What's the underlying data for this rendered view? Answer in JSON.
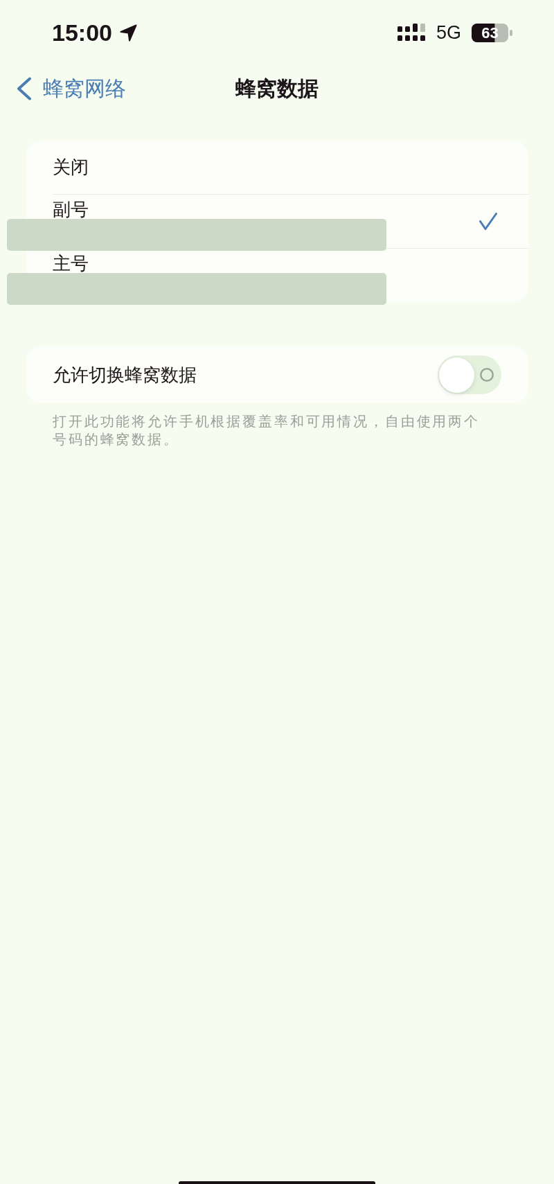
{
  "status_bar": {
    "time": "15:00",
    "network": "5G",
    "battery": "63"
  },
  "nav_bar": {
    "back_label": "蜂窝网络",
    "title": "蜂窝数据"
  },
  "options": [
    {
      "label": "关闭",
      "selected": false,
      "redacted": false
    },
    {
      "label": "副号",
      "selected": true,
      "redacted": true
    },
    {
      "label": "主号",
      "selected": false,
      "redacted": true
    }
  ],
  "switch_row": {
    "label": "允许切换蜂窝数据",
    "on": false
  },
  "footer_note": "打开此功能将允许手机根据覆盖率和可用情况，自由使用两个号码的蜂窝数据。"
}
